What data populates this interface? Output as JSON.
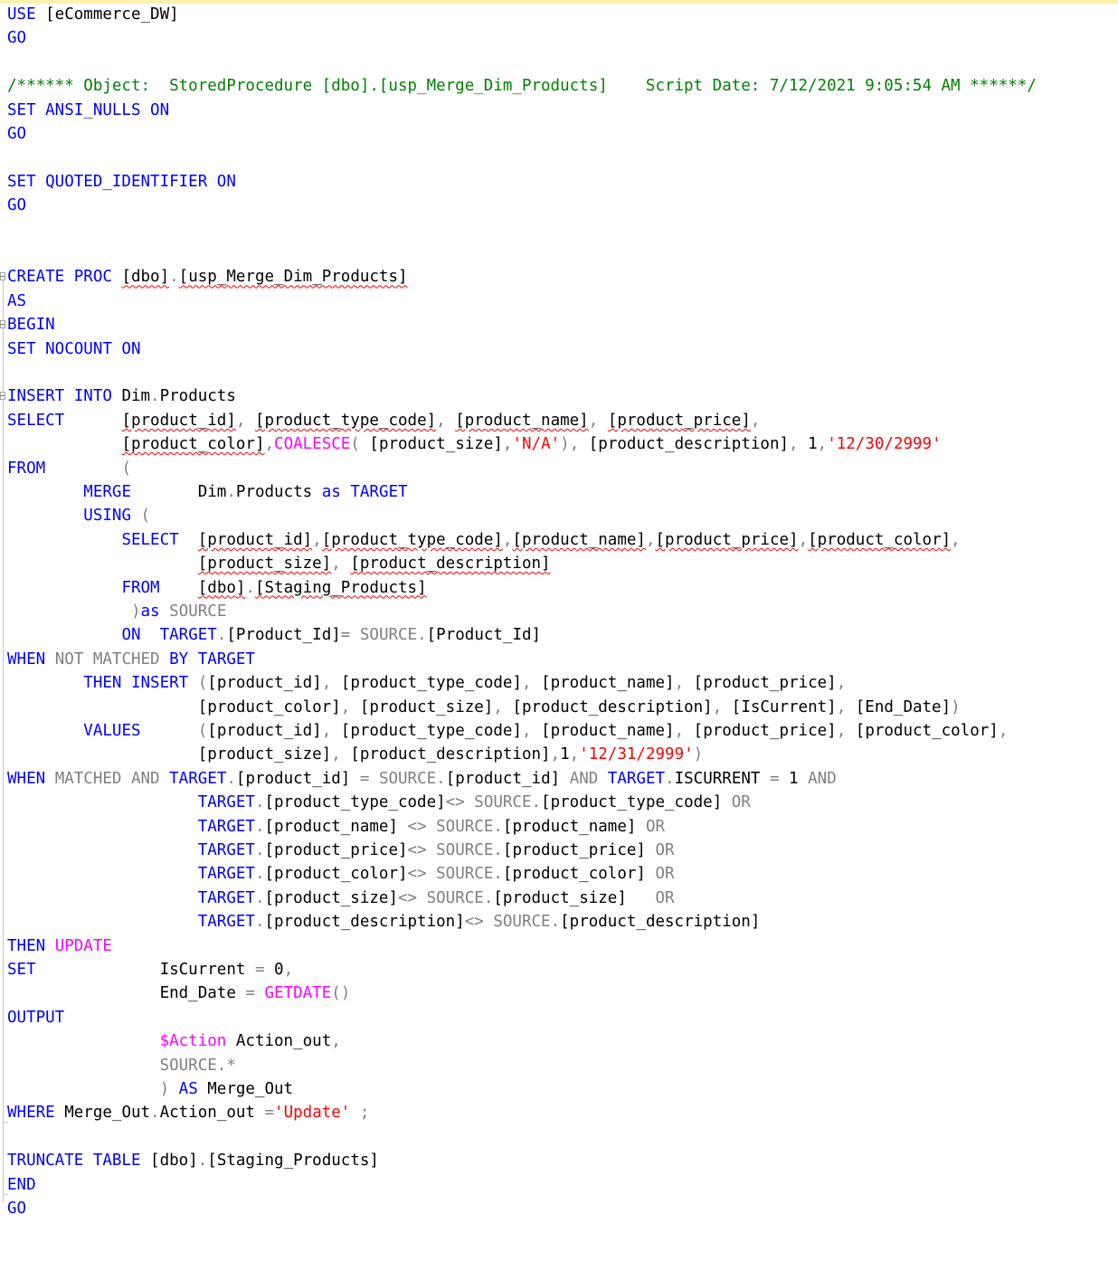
{
  "colors": {
    "keyword": "#0000ff",
    "operator": "#808080",
    "string": "#ff0000",
    "function": "#ff00ff",
    "comment": "#008000",
    "identifier": "#000000",
    "squiggle": "#ff0000"
  },
  "editor": {
    "lines": [
      [
        [
          "k",
          "USE"
        ],
        [
          "t",
          " [eCommerce_DW]"
        ]
      ],
      [
        [
          "k",
          "GO"
        ]
      ],
      [],
      [
        [
          "c",
          "/****** Object:  StoredProcedure [dbo].[usp_Merge_Dim_Products]    Script Date: 7/12/2021 9:05:54 AM ******/"
        ]
      ],
      [
        [
          "k",
          "SET ANSI_NULLS ON"
        ]
      ],
      [
        [
          "k",
          "GO"
        ]
      ],
      [],
      [
        [
          "k",
          "SET QUOTED_IDENTIFIER ON"
        ]
      ],
      [
        [
          "k",
          "GO"
        ]
      ],
      [],
      [],
      [
        [
          "k",
          "CREATE PROC "
        ],
        [
          "sq",
          "[dbo]"
        ],
        [
          "g",
          "."
        ],
        [
          "sq",
          "[usp_Merge_Dim_Products]"
        ]
      ],
      [
        [
          "k",
          "AS"
        ]
      ],
      [
        [
          "k",
          "BEGIN"
        ]
      ],
      [
        [
          "k",
          "SET NOCOUNT ON"
        ]
      ],
      [],
      [
        [
          "k",
          "INSERT INTO "
        ],
        [
          "t",
          "Dim"
        ],
        [
          "g",
          "."
        ],
        [
          "t",
          "Products"
        ]
      ],
      [
        [
          "k",
          "SELECT"
        ],
        [
          "t",
          "      "
        ],
        [
          "sq",
          "[product_id]"
        ],
        [
          "g",
          ", "
        ],
        [
          "sq",
          "[product_type_code]"
        ],
        [
          "g",
          ", "
        ],
        [
          "sq",
          "[product_name]"
        ],
        [
          "g",
          ", "
        ],
        [
          "sq",
          "[product_price]"
        ],
        [
          "g",
          ","
        ]
      ],
      [
        [
          "t",
          "            "
        ],
        [
          "sq",
          "[product_color]"
        ],
        [
          "g",
          ","
        ],
        [
          "f",
          "COALESCE"
        ],
        [
          "g",
          "( "
        ],
        [
          "t",
          "[product_size]"
        ],
        [
          "g",
          ","
        ],
        [
          "s",
          "'N/A'"
        ],
        [
          "g",
          "), "
        ],
        [
          "t",
          "[product_description]"
        ],
        [
          "g",
          ", "
        ],
        [
          "t",
          "1"
        ],
        [
          "g",
          ","
        ],
        [
          "s",
          "'12/30/2999'"
        ]
      ],
      [
        [
          "k",
          "FROM"
        ],
        [
          "t",
          "        "
        ],
        [
          "g",
          "("
        ]
      ],
      [
        [
          "t",
          "        "
        ],
        [
          "k",
          "MERGE"
        ],
        [
          "t",
          "       Dim"
        ],
        [
          "g",
          "."
        ],
        [
          "t",
          "Products "
        ],
        [
          "k",
          "as"
        ],
        [
          "t",
          " "
        ],
        [
          "k",
          "TARGET"
        ]
      ],
      [
        [
          "t",
          "        "
        ],
        [
          "k",
          "USING"
        ],
        [
          "t",
          " "
        ],
        [
          "g",
          "("
        ]
      ],
      [
        [
          "t",
          "            "
        ],
        [
          "k",
          "SELECT"
        ],
        [
          "t",
          "  "
        ],
        [
          "sq",
          "[product_id]"
        ],
        [
          "g",
          ","
        ],
        [
          "sq",
          "[product_type_code]"
        ],
        [
          "g",
          ","
        ],
        [
          "sq",
          "[product_name]"
        ],
        [
          "g",
          ","
        ],
        [
          "sq",
          "[product_price]"
        ],
        [
          "g",
          ","
        ],
        [
          "sq",
          "[product_color]"
        ],
        [
          "g",
          ","
        ]
      ],
      [
        [
          "t",
          "                    "
        ],
        [
          "sq",
          "[product_size]"
        ],
        [
          "g",
          ", "
        ],
        [
          "sq",
          "[product_description]"
        ]
      ],
      [
        [
          "t",
          "            "
        ],
        [
          "k",
          "FROM"
        ],
        [
          "t",
          "    "
        ],
        [
          "sq",
          "[dbo]"
        ],
        [
          "g",
          "."
        ],
        [
          "sq",
          "[Staging_Products]"
        ]
      ],
      [
        [
          "t",
          "             "
        ],
        [
          "g",
          ")"
        ],
        [
          "k",
          "as"
        ],
        [
          "t",
          " "
        ],
        [
          "g",
          "SOURCE"
        ]
      ],
      [
        [
          "t",
          "            "
        ],
        [
          "k",
          "ON"
        ],
        [
          "t",
          "  "
        ],
        [
          "k",
          "TARGET"
        ],
        [
          "g",
          "."
        ],
        [
          "t",
          "[Product_Id]"
        ],
        [
          "g",
          "= "
        ],
        [
          "g",
          "SOURCE"
        ],
        [
          "g",
          "."
        ],
        [
          "t",
          "[Product_Id]"
        ]
      ],
      [
        [
          "k",
          "WHEN "
        ],
        [
          "g",
          "NOT "
        ],
        [
          "g",
          "MATCHED "
        ],
        [
          "k",
          "BY "
        ],
        [
          "k",
          "TARGET"
        ]
      ],
      [
        [
          "t",
          "        "
        ],
        [
          "k",
          "THEN "
        ],
        [
          "k",
          "INSERT"
        ],
        [
          "t",
          " "
        ],
        [
          "g",
          "("
        ],
        [
          "t",
          "[product_id]"
        ],
        [
          "g",
          ", "
        ],
        [
          "t",
          "[product_type_code]"
        ],
        [
          "g",
          ", "
        ],
        [
          "t",
          "[product_name]"
        ],
        [
          "g",
          ", "
        ],
        [
          "t",
          "[product_price]"
        ],
        [
          "g",
          ","
        ]
      ],
      [
        [
          "t",
          "                    "
        ],
        [
          "t",
          "[product_color]"
        ],
        [
          "g",
          ", "
        ],
        [
          "t",
          "[product_size]"
        ],
        [
          "g",
          ", "
        ],
        [
          "t",
          "[product_description]"
        ],
        [
          "g",
          ", "
        ],
        [
          "t",
          "[IsCurrent]"
        ],
        [
          "g",
          ", "
        ],
        [
          "t",
          "[End_Date]"
        ],
        [
          "g",
          ")"
        ]
      ],
      [
        [
          "t",
          "        "
        ],
        [
          "k",
          "VALUES"
        ],
        [
          "t",
          "      "
        ],
        [
          "g",
          "("
        ],
        [
          "t",
          "[product_id]"
        ],
        [
          "g",
          ", "
        ],
        [
          "t",
          "[product_type_code]"
        ],
        [
          "g",
          ", "
        ],
        [
          "t",
          "[product_name]"
        ],
        [
          "g",
          ", "
        ],
        [
          "t",
          "[product_price]"
        ],
        [
          "g",
          ", "
        ],
        [
          "t",
          "[product_color]"
        ],
        [
          "g",
          ","
        ]
      ],
      [
        [
          "t",
          "                    "
        ],
        [
          "t",
          "[product_size]"
        ],
        [
          "g",
          ", "
        ],
        [
          "t",
          "[product_description]"
        ],
        [
          "g",
          ","
        ],
        [
          "t",
          "1"
        ],
        [
          "g",
          ","
        ],
        [
          "s",
          "'12/31/2999'"
        ],
        [
          "g",
          ")"
        ]
      ],
      [
        [
          "k",
          "WHEN "
        ],
        [
          "g",
          "MATCHED "
        ],
        [
          "g",
          "AND "
        ],
        [
          "k",
          "TARGET"
        ],
        [
          "g",
          "."
        ],
        [
          "t",
          "[product_id] "
        ],
        [
          "g",
          "= "
        ],
        [
          "g",
          "SOURCE"
        ],
        [
          "g",
          "."
        ],
        [
          "t",
          "[product_id] "
        ],
        [
          "g",
          "AND "
        ],
        [
          "k",
          "TARGET"
        ],
        [
          "g",
          "."
        ],
        [
          "t",
          "ISCURRENT "
        ],
        [
          "g",
          "= "
        ],
        [
          "t",
          "1 "
        ],
        [
          "g",
          "AND"
        ]
      ],
      [
        [
          "t",
          "                    "
        ],
        [
          "k",
          "TARGET"
        ],
        [
          "g",
          "."
        ],
        [
          "t",
          "[product_type_code]"
        ],
        [
          "g",
          "<> "
        ],
        [
          "g",
          "SOURCE"
        ],
        [
          "g",
          "."
        ],
        [
          "t",
          "[product_type_code] "
        ],
        [
          "g",
          "OR"
        ]
      ],
      [
        [
          "t",
          "                    "
        ],
        [
          "k",
          "TARGET"
        ],
        [
          "g",
          "."
        ],
        [
          "t",
          "[product_name] "
        ],
        [
          "g",
          "<> "
        ],
        [
          "g",
          "SOURCE"
        ],
        [
          "g",
          "."
        ],
        [
          "t",
          "[product_name] "
        ],
        [
          "g",
          "OR"
        ]
      ],
      [
        [
          "t",
          "                    "
        ],
        [
          "k",
          "TARGET"
        ],
        [
          "g",
          "."
        ],
        [
          "t",
          "[product_price]"
        ],
        [
          "g",
          "<> "
        ],
        [
          "g",
          "SOURCE"
        ],
        [
          "g",
          "."
        ],
        [
          "t",
          "[product_price] "
        ],
        [
          "g",
          "OR"
        ]
      ],
      [
        [
          "t",
          "                    "
        ],
        [
          "k",
          "TARGET"
        ],
        [
          "g",
          "."
        ],
        [
          "t",
          "[product_color]"
        ],
        [
          "g",
          "<> "
        ],
        [
          "g",
          "SOURCE"
        ],
        [
          "g",
          "."
        ],
        [
          "t",
          "[product_color] "
        ],
        [
          "g",
          "OR"
        ]
      ],
      [
        [
          "t",
          "                    "
        ],
        [
          "k",
          "TARGET"
        ],
        [
          "g",
          "."
        ],
        [
          "t",
          "[product_size]"
        ],
        [
          "g",
          "<> "
        ],
        [
          "g",
          "SOURCE"
        ],
        [
          "g",
          "."
        ],
        [
          "t",
          "[product_size]   "
        ],
        [
          "g",
          "OR"
        ]
      ],
      [
        [
          "t",
          "                    "
        ],
        [
          "k",
          "TARGET"
        ],
        [
          "g",
          "."
        ],
        [
          "t",
          "[product_description]"
        ],
        [
          "g",
          "<> "
        ],
        [
          "g",
          "SOURCE"
        ],
        [
          "g",
          "."
        ],
        [
          "t",
          "[product_description]"
        ]
      ],
      [
        [
          "k",
          "THEN "
        ],
        [
          "f",
          "UPDATE"
        ]
      ],
      [
        [
          "k",
          "SET"
        ],
        [
          "t",
          "             IsCurrent "
        ],
        [
          "g",
          "= "
        ],
        [
          "t",
          "0"
        ],
        [
          "g",
          ","
        ]
      ],
      [
        [
          "t",
          "                "
        ],
        [
          "t",
          "End_Date "
        ],
        [
          "g",
          "= "
        ],
        [
          "f",
          "GETDATE"
        ],
        [
          "g",
          "()"
        ]
      ],
      [
        [
          "k",
          "OUTPUT"
        ]
      ],
      [
        [
          "t",
          "                "
        ],
        [
          "f",
          "$Action"
        ],
        [
          "t",
          " Action_out"
        ],
        [
          "g",
          ","
        ]
      ],
      [
        [
          "t",
          "                "
        ],
        [
          "g",
          "SOURCE"
        ],
        [
          "g",
          ".*"
        ]
      ],
      [
        [
          "t",
          "                "
        ],
        [
          "g",
          ") "
        ],
        [
          "k",
          "AS"
        ],
        [
          "t",
          " Merge_Out"
        ]
      ],
      [
        [
          "k",
          "WHERE"
        ],
        [
          "t",
          " Merge_Out"
        ],
        [
          "g",
          "."
        ],
        [
          "t",
          "Action_out "
        ],
        [
          "g",
          "="
        ],
        [
          "s",
          "'Update'"
        ],
        [
          "t",
          " "
        ],
        [
          "g",
          ";"
        ]
      ],
      [],
      [
        [
          "k",
          "TRUNCATE TABLE"
        ],
        [
          "t",
          " [dbo]"
        ],
        [
          "g",
          "."
        ],
        [
          "t",
          "[Staging_Products]"
        ]
      ],
      [
        [
          "k",
          "END"
        ]
      ],
      [
        [
          "k",
          "GO"
        ]
      ]
    ]
  }
}
